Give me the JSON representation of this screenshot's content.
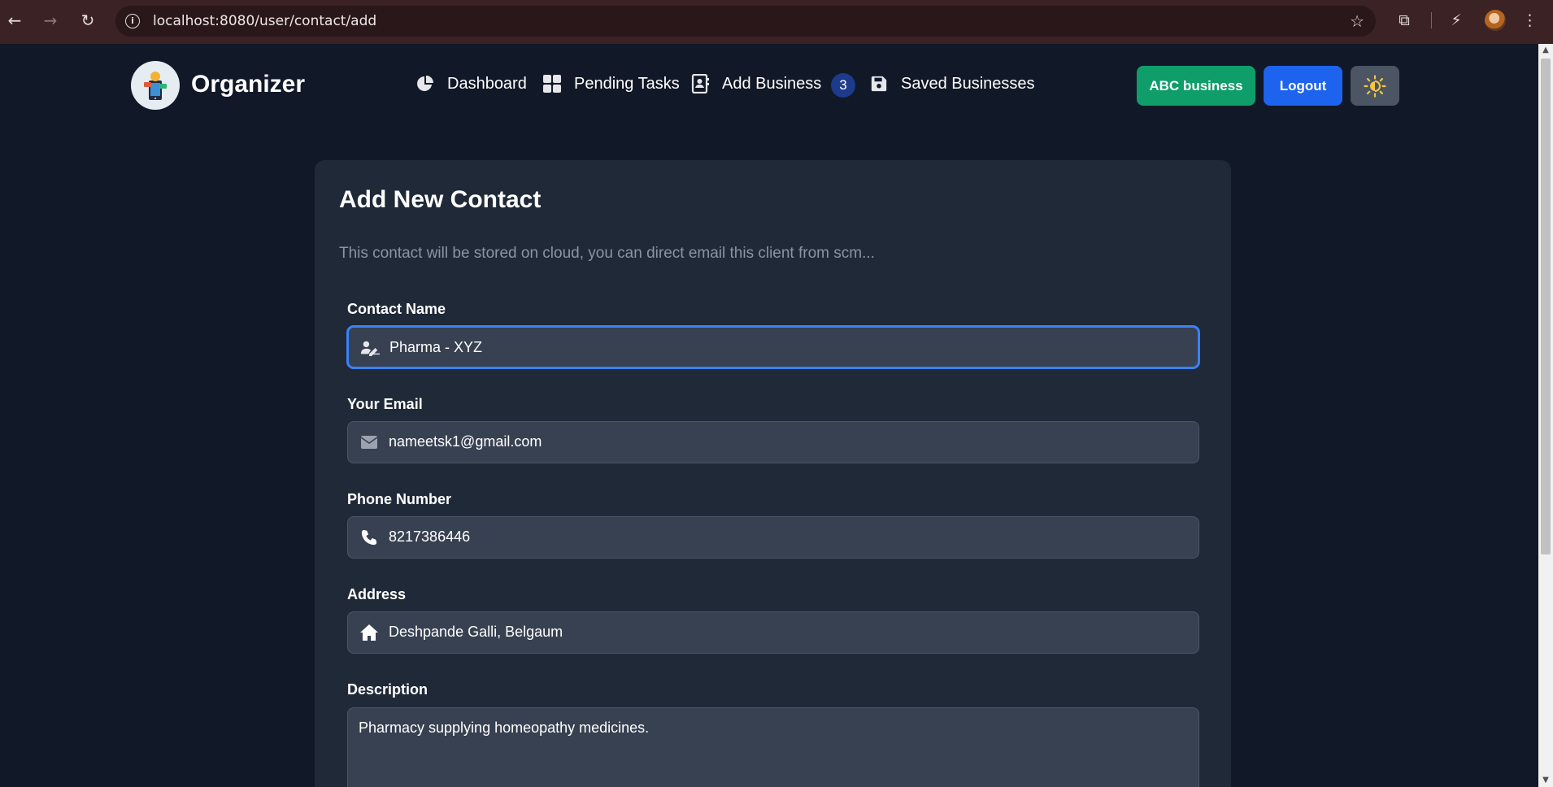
{
  "browser": {
    "url": "localhost:8080/user/contact/add",
    "back_icon": "back-arrow-icon",
    "forward_icon": "forward-arrow-icon",
    "reload_icon": "reload-icon"
  },
  "navbar": {
    "brand": "Organizer",
    "items": [
      {
        "label": "Dashboard",
        "icon": "pie-chart-icon"
      },
      {
        "label": "Pending Tasks",
        "icon": "grid-icon"
      },
      {
        "label": "Add Business",
        "icon": "contact-book-icon"
      },
      {
        "label": "Saved Businesses",
        "icon": "save-icon"
      }
    ],
    "badge_count": "3",
    "business_button": "ABC business",
    "logout_button": "Logout",
    "theme_icon": "sun-icon"
  },
  "form": {
    "title": "Add New Contact",
    "subtitle": "This contact will be stored on cloud, you can direct email this client from scm...",
    "fields": [
      {
        "label": "Contact Name",
        "value": "Pharma - XYZ",
        "icon": "user-edit-icon"
      },
      {
        "label": "Your Email",
        "value": "nameetsk1@gmail.com",
        "icon": "envelope-icon"
      },
      {
        "label": "Phone Number",
        "value": "8217386446",
        "icon": "phone-icon"
      },
      {
        "label": "Address",
        "value": "Deshpande Galli, Belgaum",
        "icon": "home-icon"
      }
    ],
    "description": {
      "label": "Description",
      "value": "Pharmacy supplying homeopathy medicines."
    }
  },
  "colors": {
    "background": "#111827",
    "card": "#1f2937",
    "input": "#374151",
    "focus": "#3b82f6",
    "business_button": "#0f9d6a",
    "logout_button": "#1d63ed",
    "badge": "#1e3a8a"
  }
}
